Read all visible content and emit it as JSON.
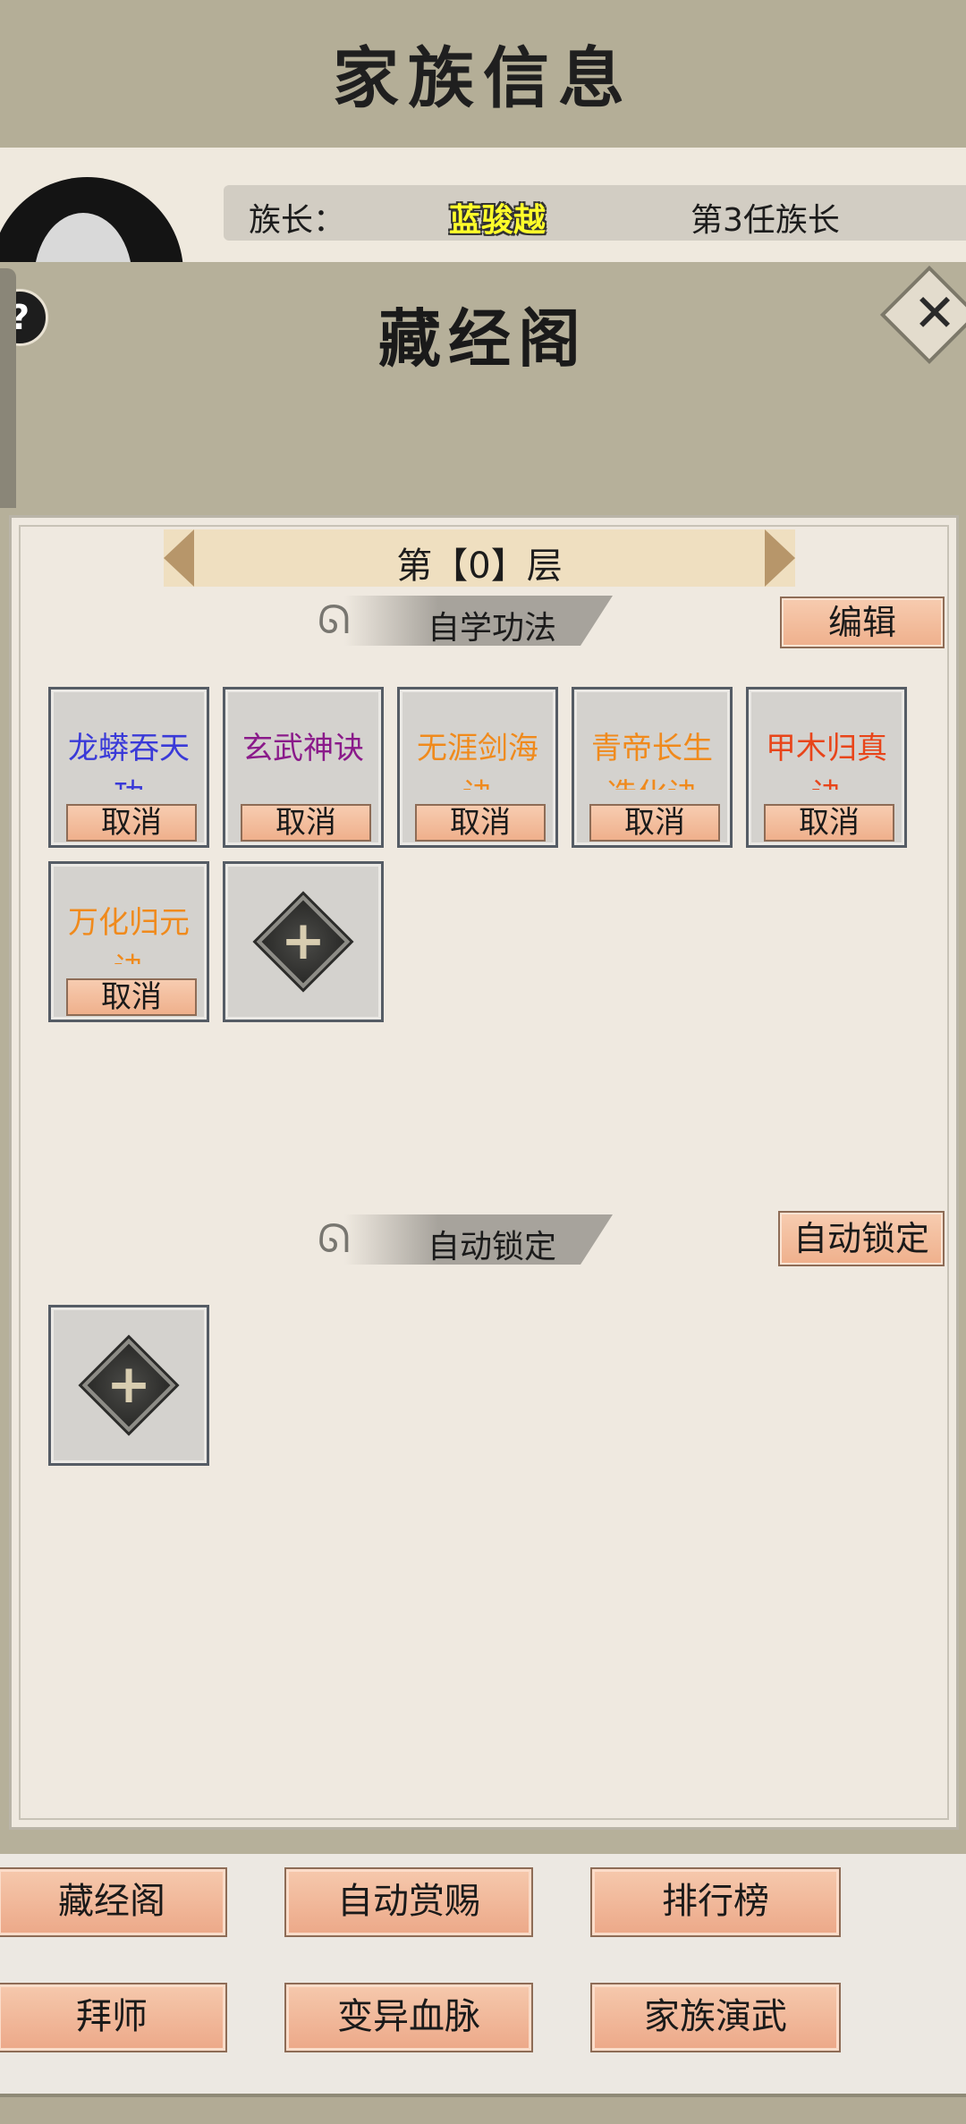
{
  "header": {
    "title": "家族信息"
  },
  "leader_bar": {
    "label": "族长：",
    "name": "蓝骏越",
    "generation": "第3任族长"
  },
  "modal": {
    "title": "藏经阁",
    "help_icon": "?",
    "close_icon": "✕",
    "floor_label": "第【0】层",
    "self_study": {
      "title": "自学功法",
      "edit_button": "编辑",
      "slots": [
        {
          "name": "龙蟒吞天功",
          "color": "#3a3ad8",
          "cancel": "取消"
        },
        {
          "name": "玄武神诀",
          "color": "#8a1a8a",
          "cancel": "取消"
        },
        {
          "name": "无涯剑海诀",
          "color": "#f08a1c",
          "cancel": "取消"
        },
        {
          "name": "青帝长生造化诀",
          "color": "#f08a1c",
          "cancel": "取消"
        },
        {
          "name": "甲木归真诀",
          "color": "#e8451a",
          "cancel": "取消"
        },
        {
          "name": "万化归元诀",
          "color": "#f08a1c",
          "cancel": "取消"
        }
      ]
    },
    "auto_lock": {
      "title": "自动锁定",
      "button": "自动锁定"
    }
  },
  "bottom_nav": {
    "row1": [
      "藏经阁",
      "自动赏赐",
      "排行榜"
    ],
    "row2": [
      "拜师",
      "变异血脉",
      "家族演武"
    ]
  },
  "colors": {
    "header_bg": "#b4ae97",
    "panel_bg": "#efe9e0",
    "button_orange": "#efb08c",
    "leader_name": "#fffd2a"
  }
}
